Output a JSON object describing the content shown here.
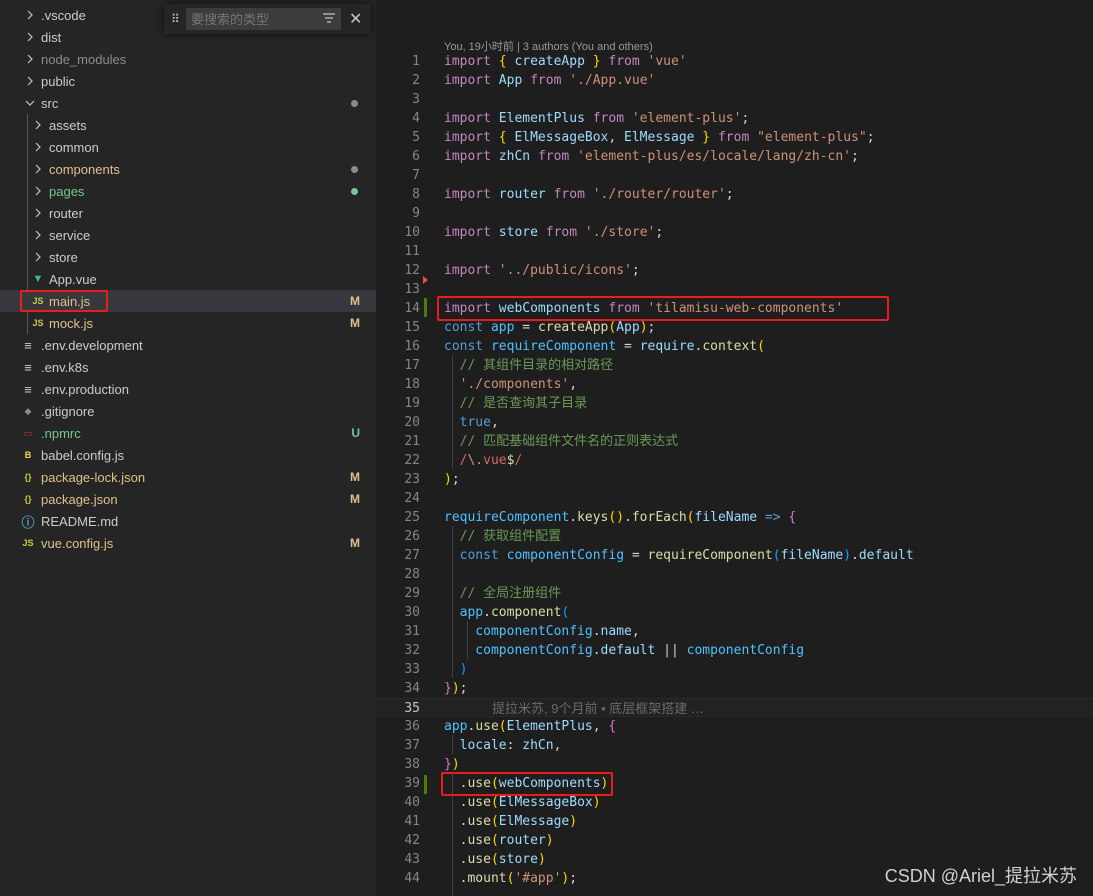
{
  "find_widget": {
    "placeholder": "要搜索的类型"
  },
  "explorer": {
    "items": [
      {
        "label": ".vscode",
        "kind": "folder",
        "depth": 0,
        "expanded": false,
        "color": "#cccccc"
      },
      {
        "label": "dist",
        "kind": "folder",
        "depth": 0,
        "expanded": false,
        "color": "#cccccc"
      },
      {
        "label": "node_modules",
        "kind": "folder",
        "depth": 0,
        "expanded": false,
        "color": "#8c8c8c"
      },
      {
        "label": "public",
        "kind": "folder",
        "depth": 0,
        "expanded": false,
        "color": "#cccccc"
      },
      {
        "label": "src",
        "kind": "folder",
        "depth": 0,
        "expanded": true,
        "color": "#cccccc",
        "dot": "#8c8c8c"
      },
      {
        "label": "assets",
        "kind": "folder",
        "depth": 1,
        "expanded": false,
        "color": "#cccccc"
      },
      {
        "label": "common",
        "kind": "folder",
        "depth": 1,
        "expanded": false,
        "color": "#cccccc"
      },
      {
        "label": "components",
        "kind": "folder",
        "depth": 1,
        "expanded": false,
        "color": "#e2c08d",
        "dot": "#8c8c8c"
      },
      {
        "label": "pages",
        "kind": "folder",
        "depth": 1,
        "expanded": false,
        "color": "#73c991",
        "dot": "#73c991"
      },
      {
        "label": "router",
        "kind": "folder",
        "depth": 1,
        "expanded": false,
        "color": "#cccccc"
      },
      {
        "label": "service",
        "kind": "folder",
        "depth": 1,
        "expanded": false,
        "color": "#cccccc"
      },
      {
        "label": "store",
        "kind": "folder",
        "depth": 1,
        "expanded": false,
        "color": "#cccccc"
      },
      {
        "label": "App.vue",
        "kind": "vue",
        "depth": 1,
        "color": "#cccccc"
      },
      {
        "label": "main.js",
        "kind": "js",
        "depth": 1,
        "color": "#e2c08d",
        "status": "M",
        "selected": true
      },
      {
        "label": "mock.js",
        "kind": "js",
        "depth": 1,
        "color": "#e2c08d",
        "status": "M"
      },
      {
        "label": ".env.development",
        "kind": "env",
        "depth": 0,
        "color": "#cccccc"
      },
      {
        "label": ".env.k8s",
        "kind": "env",
        "depth": 0,
        "color": "#cccccc"
      },
      {
        "label": ".env.production",
        "kind": "env",
        "depth": 0,
        "color": "#cccccc"
      },
      {
        "label": ".gitignore",
        "kind": "git",
        "depth": 0,
        "color": "#cccccc"
      },
      {
        "label": ".npmrc",
        "kind": "npm",
        "depth": 0,
        "color": "#73c991",
        "status": "U"
      },
      {
        "label": "babel.config.js",
        "kind": "babel",
        "depth": 0,
        "color": "#cccccc"
      },
      {
        "label": "package-lock.json",
        "kind": "json",
        "depth": 0,
        "color": "#e2c08d",
        "status": "M"
      },
      {
        "label": "package.json",
        "kind": "json",
        "depth": 0,
        "color": "#e2c08d",
        "status": "M"
      },
      {
        "label": "README.md",
        "kind": "info",
        "depth": 0,
        "color": "#cccccc"
      },
      {
        "label": "vue.config.js",
        "kind": "js",
        "depth": 0,
        "color": "#e2c08d",
        "status": "M"
      }
    ]
  },
  "editor": {
    "codelens": "You, 19小时前 | 3 authors (You and others)",
    "current_line": 35,
    "blame": "提拉米苏, 9个月前 • 底层框架搭建 …",
    "lines": [
      {
        "n": "1",
        "t": [
          [
            "import ",
            "k-imp"
          ],
          [
            "{ ",
            "k-b1"
          ],
          [
            "createApp",
            "k-var"
          ],
          [
            " } ",
            "k-b1"
          ],
          [
            "from ",
            "k-imp"
          ],
          [
            "'vue'",
            "k-str"
          ]
        ]
      },
      {
        "n": "2",
        "t": [
          [
            "import ",
            "k-imp"
          ],
          [
            "App ",
            "k-var"
          ],
          [
            "from ",
            "k-imp"
          ],
          [
            "'./App.vue'",
            "k-str"
          ]
        ]
      },
      {
        "n": "3",
        "t": []
      },
      {
        "n": "4",
        "t": [
          [
            "import ",
            "k-imp"
          ],
          [
            "ElementPlus ",
            "k-var"
          ],
          [
            "from ",
            "k-imp"
          ],
          [
            "'element-plus'",
            "k-str"
          ],
          [
            ";",
            "k-pun"
          ]
        ]
      },
      {
        "n": "5",
        "t": [
          [
            "import ",
            "k-imp"
          ],
          [
            "{ ",
            "k-b1"
          ],
          [
            "ElMessageBox",
            "k-var"
          ],
          [
            ", ",
            "k-pun"
          ],
          [
            "ElMessage",
            "k-var"
          ],
          [
            " } ",
            "k-b1"
          ],
          [
            "from ",
            "k-imp"
          ],
          [
            "\"element-plus\"",
            "k-str"
          ],
          [
            ";",
            "k-pun"
          ]
        ]
      },
      {
        "n": "6",
        "t": [
          [
            "import ",
            "k-imp"
          ],
          [
            "zhCn ",
            "k-var"
          ],
          [
            "from ",
            "k-imp"
          ],
          [
            "'element-plus/es/locale/lang/zh-cn'",
            "k-str"
          ],
          [
            ";",
            "k-pun"
          ]
        ]
      },
      {
        "n": "7",
        "t": []
      },
      {
        "n": "8",
        "t": [
          [
            "import ",
            "k-imp"
          ],
          [
            "router ",
            "k-var"
          ],
          [
            "from ",
            "k-imp"
          ],
          [
            "'./router/router'",
            "k-str"
          ],
          [
            ";",
            "k-pun"
          ]
        ]
      },
      {
        "n": "9",
        "t": []
      },
      {
        "n": "10",
        "t": [
          [
            "import ",
            "k-imp"
          ],
          [
            "store ",
            "k-var"
          ],
          [
            "from ",
            "k-imp"
          ],
          [
            "'./store'",
            "k-str"
          ],
          [
            ";",
            "k-pun"
          ]
        ]
      },
      {
        "n": "11",
        "t": []
      },
      {
        "n": "12",
        "t": [
          [
            "import ",
            "k-imp"
          ],
          [
            "'../public/icons'",
            "k-str"
          ],
          [
            ";",
            "k-pun"
          ]
        ]
      },
      {
        "n": "13",
        "t": []
      },
      {
        "n": "14",
        "t": [
          [
            "import ",
            "k-imp"
          ],
          [
            "webComponents ",
            "k-var"
          ],
          [
            "from ",
            "k-imp"
          ],
          [
            "'tilamisu-web-components'",
            "k-str"
          ]
        ]
      },
      {
        "n": "15",
        "t": [
          [
            "const ",
            "k-kw"
          ],
          [
            "app ",
            "k-const"
          ],
          [
            "= ",
            "k-pun"
          ],
          [
            "createApp",
            "k-fn"
          ],
          [
            "(",
            "k-b1"
          ],
          [
            "App",
            "k-var"
          ],
          [
            ")",
            "k-b1"
          ],
          [
            ";",
            "k-pun"
          ]
        ]
      },
      {
        "n": "16",
        "t": [
          [
            "const ",
            "k-kw"
          ],
          [
            "requireComponent ",
            "k-const"
          ],
          [
            "= ",
            "k-pun"
          ],
          [
            "require",
            "k-var"
          ],
          [
            ".",
            "k-pun"
          ],
          [
            "context",
            "k-fn"
          ],
          [
            "(",
            "k-b1"
          ]
        ]
      },
      {
        "n": "17",
        "t": [
          [
            "  // 其组件目录的相对路径",
            "k-cm"
          ]
        ]
      },
      {
        "n": "18",
        "t": [
          [
            "  './components'",
            "k-str"
          ],
          [
            ",",
            "k-pun"
          ]
        ]
      },
      {
        "n": "19",
        "t": [
          [
            "  // 是否查询其子目录",
            "k-cm"
          ]
        ]
      },
      {
        "n": "20",
        "t": [
          [
            "  true",
            "k-kw"
          ],
          [
            ",",
            "k-pun"
          ]
        ]
      },
      {
        "n": "21",
        "t": [
          [
            "  // 匹配基础组件文件名的正则表达式",
            "k-cm"
          ]
        ]
      },
      {
        "n": "22",
        "t": [
          [
            "  /",
            "k-rx"
          ],
          [
            "\\.",
            "k-str"
          ],
          [
            "vue",
            "k-rx"
          ],
          [
            "$",
            "k-fn"
          ],
          [
            "/",
            "k-rx"
          ]
        ]
      },
      {
        "n": "23",
        "t": [
          [
            ")",
            "k-b1"
          ],
          [
            ";",
            "k-pun"
          ]
        ]
      },
      {
        "n": "24",
        "t": []
      },
      {
        "n": "25",
        "t": [
          [
            "requireComponent",
            "k-const"
          ],
          [
            ".",
            "k-pun"
          ],
          [
            "keys",
            "k-fn"
          ],
          [
            "()",
            "k-b1"
          ],
          [
            ".",
            "k-pun"
          ],
          [
            "forEach",
            "k-fn"
          ],
          [
            "(",
            "k-b1"
          ],
          [
            "fileName ",
            "k-var"
          ],
          [
            "=> ",
            "k-kw"
          ],
          [
            "{",
            "k-b2"
          ]
        ]
      },
      {
        "n": "26",
        "t": [
          [
            "  // 获取组件配置",
            "k-cm"
          ]
        ]
      },
      {
        "n": "27",
        "t": [
          [
            "  const ",
            "k-kw"
          ],
          [
            "componentConfig ",
            "k-const"
          ],
          [
            "= ",
            "k-pun"
          ],
          [
            "requireComponent",
            "k-fn"
          ],
          [
            "(",
            "k-b3"
          ],
          [
            "fileName",
            "k-var"
          ],
          [
            ")",
            "k-b3"
          ],
          [
            ".",
            "k-pun"
          ],
          [
            "default",
            "k-var"
          ]
        ]
      },
      {
        "n": "28",
        "t": []
      },
      {
        "n": "29",
        "t": [
          [
            "  // 全局注册组件",
            "k-cm"
          ]
        ]
      },
      {
        "n": "30",
        "t": [
          [
            "  app",
            "k-const"
          ],
          [
            ".",
            "k-pun"
          ],
          [
            "component",
            "k-fn"
          ],
          [
            "(",
            "k-b3"
          ]
        ]
      },
      {
        "n": "31",
        "t": [
          [
            "    componentConfig",
            "k-const"
          ],
          [
            ".",
            "k-pun"
          ],
          [
            "name",
            "k-var"
          ],
          [
            ",",
            "k-pun"
          ]
        ]
      },
      {
        "n": "32",
        "t": [
          [
            "    componentConfig",
            "k-const"
          ],
          [
            ".",
            "k-pun"
          ],
          [
            "default ",
            "k-var"
          ],
          [
            "|| ",
            "k-pun"
          ],
          [
            "componentConfig",
            "k-const"
          ]
        ]
      },
      {
        "n": "33",
        "t": [
          [
            "  )",
            "k-b3"
          ]
        ]
      },
      {
        "n": "34",
        "t": [
          [
            "}",
            "k-b2"
          ],
          [
            ")",
            "k-b1"
          ],
          [
            ";",
            "k-pun"
          ]
        ]
      },
      {
        "n": "35",
        "t": []
      },
      {
        "n": "36",
        "t": [
          [
            "app",
            "k-const"
          ],
          [
            ".",
            "k-pun"
          ],
          [
            "use",
            "k-fn"
          ],
          [
            "(",
            "k-b1"
          ],
          [
            "ElementPlus",
            "k-var"
          ],
          [
            ", ",
            "k-pun"
          ],
          [
            "{",
            "k-b2"
          ]
        ]
      },
      {
        "n": "37",
        "t": [
          [
            "  locale",
            "k-prop"
          ],
          [
            ": ",
            "k-pun"
          ],
          [
            "zhCn",
            "k-var"
          ],
          [
            ",",
            "k-pun"
          ]
        ]
      },
      {
        "n": "38",
        "t": [
          [
            "}",
            "k-b2"
          ],
          [
            ")",
            "k-b1"
          ]
        ]
      },
      {
        "n": "39",
        "t": [
          [
            "  .",
            "k-pun"
          ],
          [
            "use",
            "k-fn"
          ],
          [
            "(",
            "k-b1"
          ],
          [
            "webComponents",
            "k-var"
          ],
          [
            ")",
            "k-b1"
          ]
        ]
      },
      {
        "n": "40",
        "t": [
          [
            "  .",
            "k-pun"
          ],
          [
            "use",
            "k-fn"
          ],
          [
            "(",
            "k-b1"
          ],
          [
            "ElMessageBox",
            "k-var"
          ],
          [
            ")",
            "k-b1"
          ]
        ]
      },
      {
        "n": "41",
        "t": [
          [
            "  .",
            "k-pun"
          ],
          [
            "use",
            "k-fn"
          ],
          [
            "(",
            "k-b1"
          ],
          [
            "ElMessage",
            "k-var"
          ],
          [
            ")",
            "k-b1"
          ]
        ]
      },
      {
        "n": "42",
        "t": [
          [
            "  .",
            "k-pun"
          ],
          [
            "use",
            "k-fn"
          ],
          [
            "(",
            "k-b1"
          ],
          [
            "router",
            "k-var"
          ],
          [
            ")",
            "k-b1"
          ]
        ]
      },
      {
        "n": "43",
        "t": [
          [
            "  .",
            "k-pun"
          ],
          [
            "use",
            "k-fn"
          ],
          [
            "(",
            "k-b1"
          ],
          [
            "store",
            "k-var"
          ],
          [
            ")",
            "k-b1"
          ]
        ]
      },
      {
        "n": "44",
        "t": [
          [
            "  .",
            "k-pun"
          ],
          [
            "mount",
            "k-fn"
          ],
          [
            "(",
            "k-b1"
          ],
          [
            "'#app'",
            "k-str"
          ],
          [
            ")",
            "k-b1"
          ],
          [
            ";",
            "k-pun"
          ]
        ]
      }
    ]
  },
  "watermark": "CSDN @Ariel_提拉米苏"
}
